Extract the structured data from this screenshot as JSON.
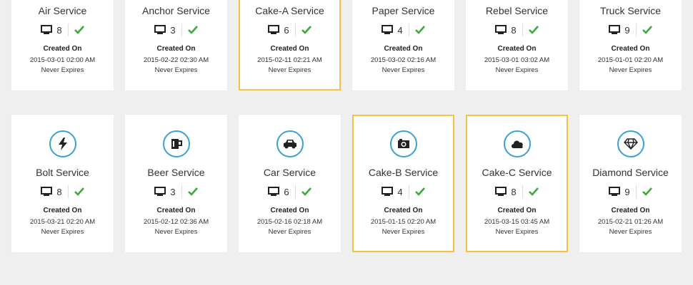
{
  "accent_color": "#3aa0d6",
  "selected_border_color": "#f5c243",
  "check_color": "#3aaa3a",
  "top_row": [
    {
      "name": "Air Service",
      "count": "8",
      "created_label": "Created On",
      "created": "2015-03-01 02:00 AM",
      "expires": "Never Expires",
      "selected": false
    },
    {
      "name": "Anchor Service",
      "count": "3",
      "created_label": "Created On",
      "created": "2015-02-22 02:30 AM",
      "expires": "Never Expires",
      "selected": false
    },
    {
      "name": "Cake-A Service",
      "count": "6",
      "created_label": "Created On",
      "created": "2015-02-11 02:21 AM",
      "expires": "Never Expires",
      "selected": true
    },
    {
      "name": "Paper Service",
      "count": "4",
      "created_label": "Created On",
      "created": "2015-03-02 02:16 AM",
      "expires": "Never Expires",
      "selected": false
    },
    {
      "name": "Rebel Service",
      "count": "8",
      "created_label": "Created On",
      "created": "2015-03-01 03:02 AM",
      "expires": "Never Expires",
      "selected": false
    },
    {
      "name": "Truck Service",
      "count": "9",
      "created_label": "Created On",
      "created": "2015-01-01 02:20 AM",
      "expires": "Never Expires",
      "selected": false
    }
  ],
  "bottom_row": [
    {
      "name": "Bolt Service",
      "icon": "bolt-icon",
      "count": "8",
      "created_label": "Created On",
      "created": "2015-03-21 02:20 AM",
      "expires": "Never Expires",
      "selected": false
    },
    {
      "name": "Beer Service",
      "icon": "beer-mug-icon",
      "count": "3",
      "created_label": "Created On",
      "created": "2015-02-12 02:36 AM",
      "expires": "Never Expires",
      "selected": false
    },
    {
      "name": "Car Service",
      "icon": "car-icon",
      "count": "6",
      "created_label": "Created On",
      "created": "2015-02-16 02:18 AM",
      "expires": "Never Expires",
      "selected": false
    },
    {
      "name": "Cake-B Service",
      "icon": "camera-icon",
      "count": "4",
      "created_label": "Created On",
      "created": "2015-01-15 02:20 AM",
      "expires": "Never Expires",
      "selected": true
    },
    {
      "name": "Cake-C Service",
      "icon": "cloud-icon",
      "count": "8",
      "created_label": "Created On",
      "created": "2015-03-15 03:45 AM",
      "expires": "Never Expires",
      "selected": true
    },
    {
      "name": "Diamond Service",
      "icon": "diamond-icon",
      "count": "9",
      "created_label": "Created On",
      "created": "2015-02-21 01:26 AM",
      "expires": "Never Expires",
      "selected": false
    }
  ]
}
